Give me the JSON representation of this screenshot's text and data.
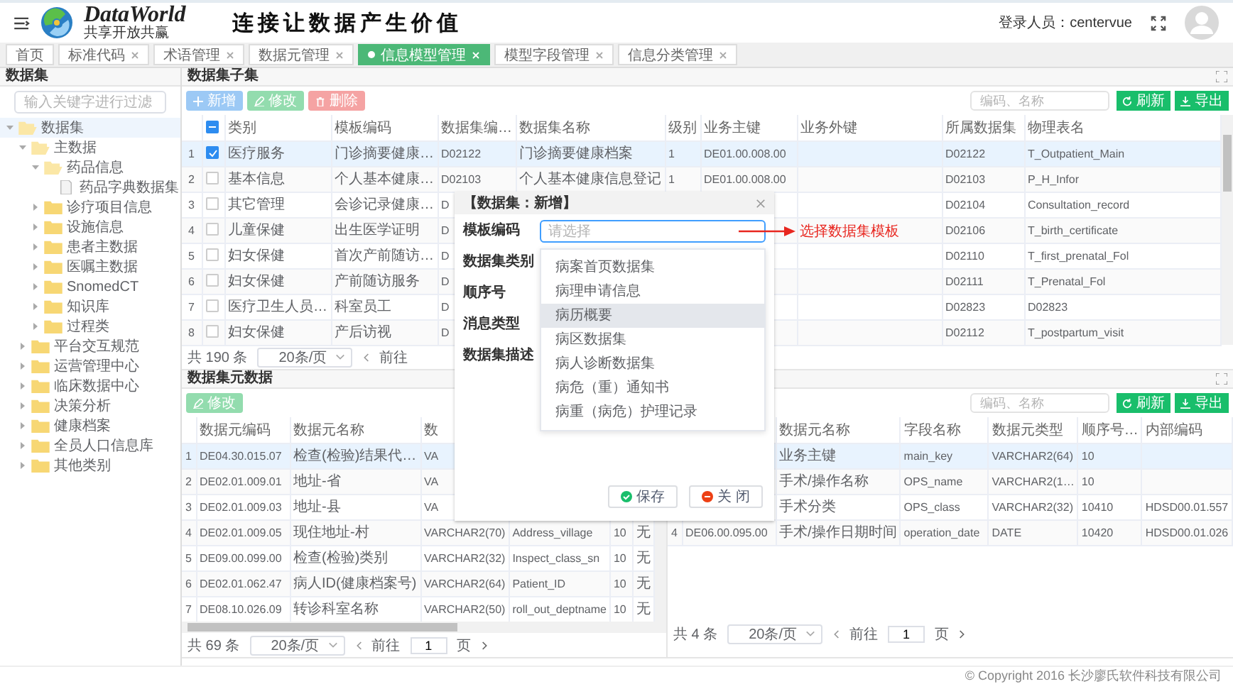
{
  "header": {
    "logo_title": "DataWorld",
    "logo_subtitle": "共享开放共赢",
    "slogan": "连接让数据产生价值",
    "user": "登录人员：centervue"
  },
  "tabs": [
    {
      "label": "首页",
      "selected": false,
      "closable": false
    },
    {
      "label": "标准代码",
      "selected": false,
      "closable": true
    },
    {
      "label": "术语管理",
      "selected": false,
      "closable": true
    },
    {
      "label": "数据元管理",
      "selected": false,
      "closable": true
    },
    {
      "label": "信息模型管理",
      "selected": true,
      "closable": true
    },
    {
      "label": "模型字段管理",
      "selected": false,
      "closable": true
    },
    {
      "label": "信息分类管理",
      "selected": false,
      "closable": true
    }
  ],
  "sidebar": {
    "title": "数据集",
    "filter": {
      "placeholder": "输入关键字进行过滤"
    },
    "tree": [
      {
        "label": "数据集",
        "kind": "folder",
        "expanded": true,
        "selected": true,
        "children": [
          {
            "label": "主数据",
            "kind": "folder",
            "expanded": true,
            "selected": false,
            "children": [
              {
                "label": "药品信息",
                "kind": "folder",
                "expanded": true,
                "selected": false,
                "children": [
                  {
                    "label": "药品字典数据集",
                    "kind": "file",
                    "selected": false
                  }
                ]
              },
              {
                "label": "诊疗项目信息",
                "kind": "folder",
                "expanded": false,
                "selected": false
              },
              {
                "label": "设施信息",
                "kind": "folder",
                "expanded": false,
                "selected": false
              },
              {
                "label": "患者主数据",
                "kind": "folder",
                "expanded": false,
                "selected": false
              },
              {
                "label": "医嘱主数据",
                "kind": "folder",
                "expanded": false,
                "selected": false
              },
              {
                "label": "SnomedCT",
                "kind": "folder",
                "expanded": false,
                "selected": false
              },
              {
                "label": "知识库",
                "kind": "folder",
                "expanded": false,
                "selected": false
              },
              {
                "label": "过程类",
                "kind": "folder",
                "expanded": false,
                "selected": false
              }
            ]
          },
          {
            "label": "平台交互规范",
            "kind": "folder",
            "expanded": false,
            "selected": false
          },
          {
            "label": "运营管理中心",
            "kind": "folder",
            "expanded": false,
            "selected": false
          },
          {
            "label": "临床数据中心",
            "kind": "folder",
            "expanded": false,
            "selected": false
          },
          {
            "label": "决策分析",
            "kind": "folder",
            "expanded": false,
            "selected": false
          },
          {
            "label": "健康档案",
            "kind": "folder",
            "expanded": false,
            "selected": false
          },
          {
            "label": "全员人口信息库",
            "kind": "folder",
            "expanded": false,
            "selected": false
          },
          {
            "label": "其他类别",
            "kind": "folder",
            "expanded": false,
            "selected": false
          }
        ]
      }
    ]
  },
  "subset_panel": {
    "title": "数据集子集",
    "buttons": [
      {
        "kind": "add",
        "label": "新增"
      },
      {
        "kind": "edit",
        "label": "修改"
      },
      {
        "kind": "delete",
        "label": "删除"
      }
    ],
    "search": {
      "placeholder": "编码、名称"
    },
    "actions": [
      {
        "kind": "refresh",
        "label": "刷新"
      },
      {
        "kind": "export",
        "label": "导出"
      }
    ],
    "table": {
      "select_all_indeterminate": true,
      "columns": {
        "category": "类别",
        "template": "模板编码",
        "code": "数据集编…",
        "name": "数据集名称",
        "level": "级别",
        "biz_key": "业务主键",
        "biz_fk": "业务外键",
        "owner": "所属数据集",
        "table_name": "物理表名"
      },
      "rows": [
        {
          "no": "1",
          "checked": true,
          "selected": true,
          "category": "医疗服务",
          "template": "门诊摘要健康…",
          "code": "D02122",
          "name": "门诊摘要健康档案",
          "level": "1",
          "biz_key": "DE01.00.008.00",
          "owner": "D02122",
          "table_name": "T_Outpatient_Main"
        },
        {
          "no": "2",
          "checked": false,
          "selected": false,
          "category": "基本信息",
          "template": "个人基本健康…",
          "code": "D02103",
          "name": "个人基本健康信息登记",
          "level": "1",
          "biz_key": "DE01.00.008.00",
          "owner": "D02103",
          "table_name": "P_H_Infor"
        },
        {
          "no": "3",
          "checked": false,
          "selected": false,
          "category": "其它管理",
          "template": "会诊记录健康…",
          "code": "D",
          "owner": "D02104",
          "table_name": "Consultation_record"
        },
        {
          "no": "4",
          "checked": false,
          "selected": false,
          "category": "儿童保健",
          "template": "出生医学证明",
          "code": "D",
          "owner": "D02106",
          "table_name": "T_birth_certificate"
        },
        {
          "no": "5",
          "checked": false,
          "selected": false,
          "category": "妇女保健",
          "template": "首次产前随访…",
          "code": "D",
          "owner": "D02110",
          "table_name": "T_first_prenatal_Fol"
        },
        {
          "no": "6",
          "checked": false,
          "selected": false,
          "category": "妇女保健",
          "template": "产前随访服务",
          "code": "D",
          "owner": "D02111",
          "table_name": "T_Prenatal_Fol"
        },
        {
          "no": "7",
          "checked": false,
          "selected": false,
          "category": "医疗卫生人员…",
          "template": "科室员工",
          "code": "D",
          "owner": "D02823",
          "table_name": "D02823"
        },
        {
          "no": "8",
          "checked": false,
          "selected": false,
          "category": "妇女保健",
          "template": "产后访视",
          "code": "D",
          "owner": "D02112",
          "table_name": "T_postpartum_visit"
        }
      ]
    },
    "pager": {
      "total": "共 190 条",
      "page_size": "20条/页",
      "goto": "前往"
    }
  },
  "element_panel": {
    "title": "数据集元数据",
    "buttons": [
      {
        "kind": "edit",
        "label": "修改"
      }
    ],
    "search": {
      "placeholder": "编码、名称"
    },
    "actions": [
      {
        "kind": "refresh",
        "label": "刷新"
      },
      {
        "kind": "export",
        "label": "导出"
      }
    ],
    "left_table": {
      "columns": {
        "code": "数据元编码",
        "name": "数据元名称",
        "type": "数"
      },
      "rows": [
        {
          "no": "1",
          "selected": true,
          "code": "DE04.30.015.07",
          "name": "检查(检验)结果代…",
          "type": "VA"
        },
        {
          "no": "2",
          "selected": false,
          "code": "DE02.01.009.01",
          "name": "地址-省",
          "type": "VA"
        },
        {
          "no": "3",
          "selected": false,
          "code": "DE02.01.009.03",
          "name": "地址-县",
          "type": "VA"
        },
        {
          "no": "4",
          "selected": false,
          "code": "DE02.01.009.05",
          "name": "现住地址-村",
          "type": "VARCHAR2(70)",
          "field": "Address_village",
          "order": "10",
          "flag": "无"
        },
        {
          "no": "5",
          "selected": false,
          "code": "DE09.00.099.00",
          "name": "检查(检验)类别",
          "type": "VARCHAR2(32)",
          "field": "Inspect_class_sn",
          "order": "10",
          "flag": "无"
        },
        {
          "no": "6",
          "selected": false,
          "code": "DE02.01.062.47",
          "name": "病人ID(健康档案号)",
          "type": "VARCHAR2(64)",
          "field": "Patient_ID",
          "order": "10",
          "flag": "无"
        },
        {
          "no": "7",
          "selected": false,
          "code": "DE08.10.026.09",
          "name": "转诊科室名称",
          "type": "VARCHAR2(50)",
          "field": "roll_out_deptname",
          "order": "10",
          "flag": "无"
        }
      ]
    },
    "left_pager": {
      "total": "共 69 条",
      "page_size": "20条/页",
      "goto": "前往",
      "page": "1",
      "unit": "页"
    },
    "right_table": {
      "columns": {
        "name": "数据元名称",
        "field": "字段名称",
        "type": "数据元类型",
        "order": "顺序号…",
        "inner": "内部编码"
      },
      "rows": [
        {
          "selected": true,
          "name": "业务主键",
          "field": "main_key",
          "type": "VARCHAR2(64)",
          "order": "10"
        },
        {
          "selected": false,
          "name": "手术/操作名称",
          "field": "OPS_name",
          "type": "VARCHAR2(1…",
          "order": "10"
        },
        {
          "selected": false,
          "name": "手术分类",
          "field": "OPS_class",
          "type": "VARCHAR2(32)",
          "order": "10410",
          "inner": "HDSD00.01.557"
        },
        {
          "no": "4",
          "selected": false,
          "code": "DE06.00.095.00",
          "name": "手术/操作日期时间",
          "field": "operation_date",
          "type": "DATE",
          "order": "10420",
          "inner": "HDSD00.01.026"
        }
      ]
    },
    "right_pager": {
      "total": "共 4 条",
      "page_size": "20条/页",
      "goto": "前往",
      "page": "1",
      "unit": "页"
    }
  },
  "dialog": {
    "title": "【数据集：新增】",
    "fields": [
      {
        "label": "模板编码"
      },
      {
        "label": "数据集类别"
      },
      {
        "label": "顺序号"
      },
      {
        "label": "消息类型"
      },
      {
        "label": "数据集描述"
      }
    ],
    "select": {
      "placeholder": "请选择"
    },
    "options": [
      {
        "label": "病案首页数据集",
        "hovered": false
      },
      {
        "label": "病理申请信息",
        "hovered": false
      },
      {
        "label": "病历概要",
        "hovered": true
      },
      {
        "label": "病区数据集",
        "hovered": false
      },
      {
        "label": "病人诊断数据集",
        "hovered": false
      },
      {
        "label": "病危（重）通知书",
        "hovered": false
      },
      {
        "label": "病重（病危）护理记录",
        "hovered": false
      }
    ],
    "buttons": [
      {
        "kind": "save",
        "label": "保存"
      },
      {
        "kind": "close",
        "label": "关 闭"
      }
    ]
  },
  "annotation": {
    "text": "选择数据集模板"
  },
  "footer": "© Copyright 2016 长沙廖氏软件科技有限公司"
}
